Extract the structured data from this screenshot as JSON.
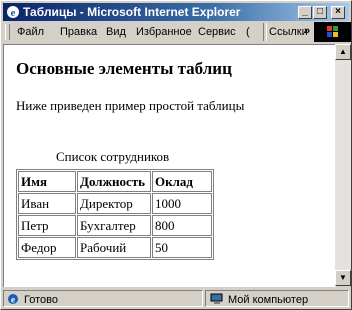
{
  "window": {
    "title": "Таблицы - Microsoft Internet Explorer",
    "min_glyph": "_",
    "max_glyph": "□",
    "close_glyph": "×"
  },
  "menubar": {
    "items": [
      "Файл",
      "Правка",
      "Вид",
      "Избранное",
      "Сервис",
      "("
    ],
    "links_label": "Ссылки",
    "chevron": "»"
  },
  "content": {
    "heading": "Основные элементы таблиц",
    "intro": "Ниже приведен пример простой таблицы",
    "caption": "Список сотрудников",
    "table": {
      "headers": [
        "Имя",
        "Должность",
        "Оклад"
      ],
      "rows": [
        [
          "Иван",
          "Директор",
          "1000"
        ],
        [
          "Петр",
          "Бухгалтер",
          "800"
        ],
        [
          "Федор",
          "Рабочий",
          "50"
        ]
      ]
    }
  },
  "scrollbar": {
    "up_glyph": "▲",
    "down_glyph": "▼"
  },
  "statusbar": {
    "status": "Готово",
    "zone": "Мой компьютер",
    "status_icon": "ie-page-icon",
    "zone_icon": "computer-icon"
  }
}
